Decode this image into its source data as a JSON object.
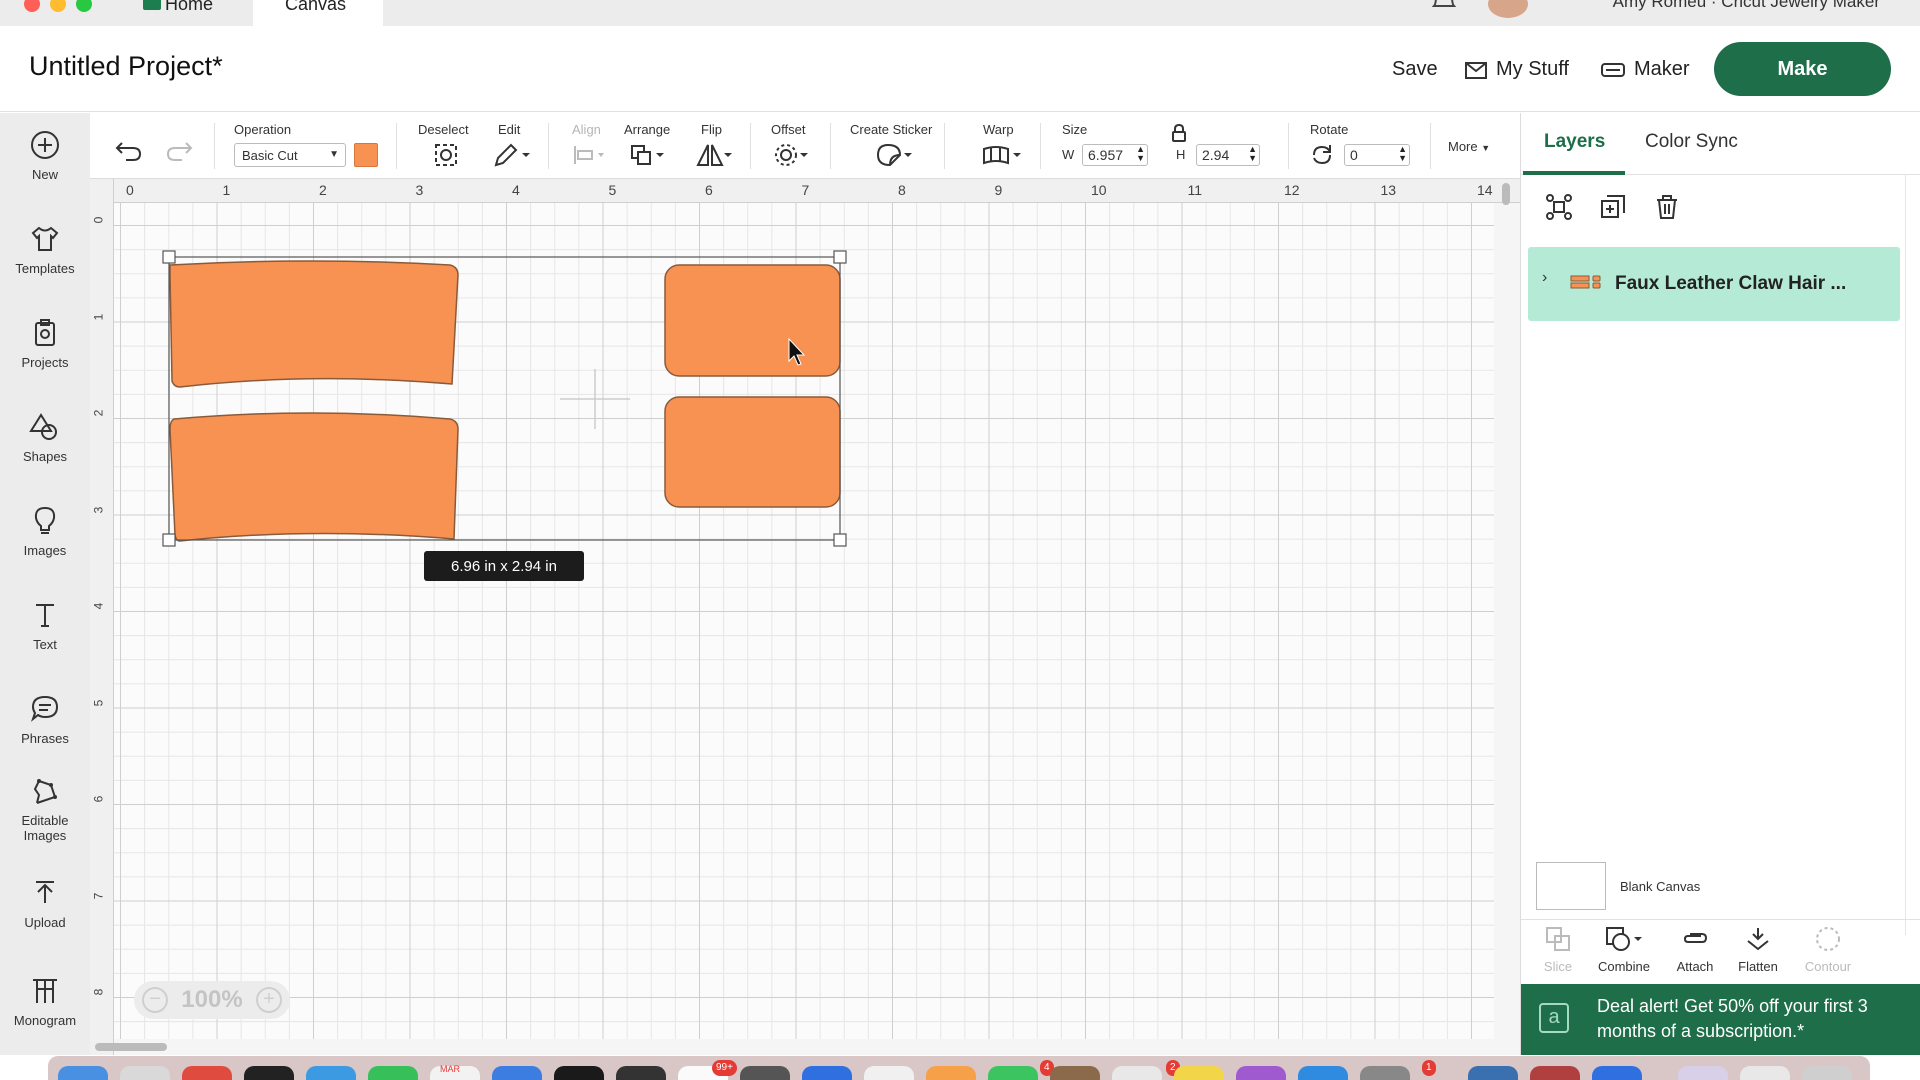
{
  "window": {
    "tabs": [
      {
        "label": "Home"
      },
      {
        "label": "Canvas"
      }
    ],
    "account": "Amy Romeu · Cricut Jewelry Maker"
  },
  "header": {
    "project_title": "Untitled Project*",
    "save_label": "Save",
    "my_stuff_label": "My Stuff",
    "maker_label": "Maker",
    "make_label": "Make"
  },
  "sidebar": {
    "items": [
      {
        "label": "New",
        "icon": "plus-circle-icon"
      },
      {
        "label": "Templates",
        "icon": "shirt-icon"
      },
      {
        "label": "Projects",
        "icon": "clipboard-icon"
      },
      {
        "label": "Shapes",
        "icon": "shapes-icon"
      },
      {
        "label": "Images",
        "icon": "lightbulb-icon"
      },
      {
        "label": "Text",
        "icon": "text-icon"
      },
      {
        "label": "Phrases",
        "icon": "speech-bubble-icon"
      },
      {
        "label": "Editable",
        "label2": "Images",
        "icon": "editable-image-icon"
      },
      {
        "label": "Upload",
        "icon": "upload-icon"
      },
      {
        "label": "Monogram",
        "icon": "monogram-icon"
      }
    ]
  },
  "toolbar": {
    "operation_label": "Operation",
    "operation_value": "Basic Cut",
    "operation_color": "#f79252",
    "deselect_label": "Deselect",
    "edit_label": "Edit",
    "align_label": "Align",
    "arrange_label": "Arrange",
    "flip_label": "Flip",
    "offset_label": "Offset",
    "create_sticker_label": "Create Sticker",
    "warp_label": "Warp",
    "size_label": "Size",
    "width_prefix": "W",
    "width_value": "6.957",
    "height_prefix": "H",
    "height_value": "2.94",
    "rotate_label": "Rotate",
    "rotate_value": "0",
    "more_label": "More"
  },
  "canvas": {
    "ruler_top": [
      "0",
      "1",
      "2",
      "3",
      "4",
      "5",
      "6",
      "7",
      "8",
      "9",
      "10",
      "11",
      "12",
      "13",
      "14"
    ],
    "ruler_left": [
      "0",
      "1",
      "2",
      "3",
      "4",
      "5",
      "6",
      "7",
      "8"
    ],
    "selection_size": "6.96  in x 2.94  in",
    "zoom": "100%",
    "shape_color": "#f79252"
  },
  "right_panel": {
    "tabs": [
      {
        "label": "Layers"
      },
      {
        "label": "Color Sync"
      }
    ],
    "layer_name": "Faux Leather Claw Hair ...",
    "blank_canvas_label": "Blank Canvas",
    "bottom_tools": [
      {
        "label": "Slice",
        "enabled": false
      },
      {
        "label": "Combine",
        "enabled": true
      },
      {
        "label": "Attach",
        "enabled": true
      },
      {
        "label": "Flatten",
        "enabled": true
      },
      {
        "label": "Contour",
        "enabled": false
      }
    ],
    "deal_text": "Deal alert! Get 50% off your first 3 months of a subscription.*"
  },
  "dock": {
    "badges": [
      "99+",
      "4",
      "2",
      "1"
    ],
    "calendar_month": "MAR"
  }
}
